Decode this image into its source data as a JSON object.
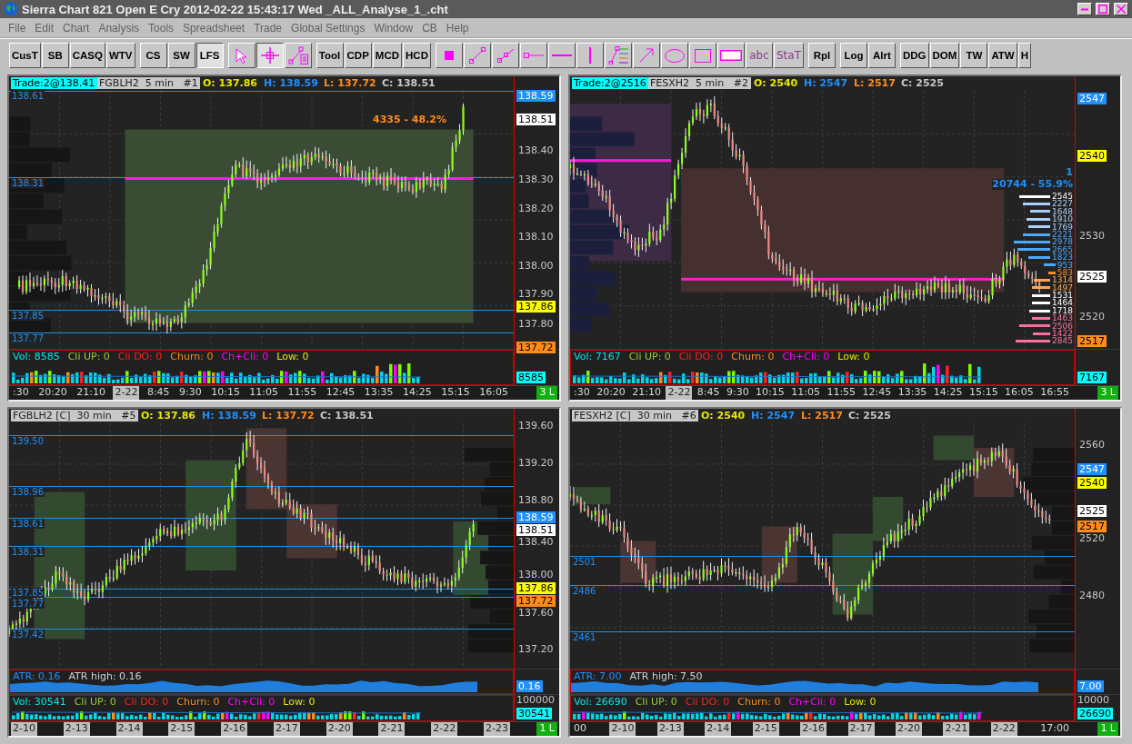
{
  "window": {
    "title": "Sierra Chart 821 Open E Cry 2012-02-22  15:43:17 Wed  _ALL_Analyse_1_.cht"
  },
  "menu": [
    "File",
    "Edit",
    "Chart",
    "Analysis",
    "Tools",
    "Spreadsheet",
    "Trade",
    "Global Settings",
    "Window",
    "CB",
    "Help"
  ],
  "toolbar": [
    [
      {
        "kind": "text",
        "label": "CusT",
        "selected": false
      },
      {
        "kind": "text",
        "label": "SB",
        "selected": false
      },
      {
        "kind": "text",
        "label": "CASQ",
        "selected": false
      },
      {
        "kind": "text",
        "label": "WTV",
        "selected": false
      }
    ],
    [
      {
        "kind": "text",
        "label": "CS",
        "selected": false
      },
      {
        "kind": "text",
        "label": "SW",
        "selected": false
      },
      {
        "kind": "text",
        "label": "LFS",
        "selected": true
      }
    ],
    [
      {
        "kind": "icon",
        "selected": false
      },
      {
        "kind": "icon",
        "selected": true
      },
      {
        "kind": "icon",
        "selected": false
      }
    ],
    [
      {
        "kind": "text",
        "label": "Tool",
        "selected": false
      },
      {
        "kind": "text",
        "label": "CDP",
        "selected": false
      },
      {
        "kind": "text",
        "label": "MCD",
        "selected": false
      },
      {
        "kind": "text",
        "label": "HCD",
        "selected": false
      }
    ],
    [
      {
        "kind": "icon",
        "selected": false
      },
      {
        "kind": "icon",
        "selected": false
      },
      {
        "kind": "icon",
        "selected": false
      },
      {
        "kind": "icon",
        "selected": false
      },
      {
        "kind": "icon",
        "selected": false
      },
      {
        "kind": "icon",
        "selected": false
      },
      {
        "kind": "icon",
        "selected": false
      },
      {
        "kind": "icon",
        "selected": false
      },
      {
        "kind": "icon",
        "selected": false
      },
      {
        "kind": "icon",
        "selected": false
      },
      {
        "kind": "icon",
        "selected": false
      },
      {
        "kind": "text",
        "label": "abc",
        "selected": false
      },
      {
        "kind": "text",
        "label": "StaT",
        "selected": false
      }
    ],
    [
      {
        "kind": "text",
        "label": "Rpl",
        "selected": false
      }
    ],
    [
      {
        "kind": "text",
        "label": "Log",
        "selected": false
      },
      {
        "kind": "text",
        "label": "Alrt",
        "selected": false
      }
    ],
    [
      {
        "kind": "text",
        "label": "DDG",
        "selected": false
      },
      {
        "kind": "text",
        "label": "DOM",
        "selected": false
      },
      {
        "kind": "text",
        "label": "TW",
        "selected": false
      },
      {
        "kind": "text",
        "label": "ATW",
        "selected": false
      },
      {
        "kind": "text",
        "label": "H",
        "selected": false
      }
    ]
  ],
  "charts": [
    {
      "header": {
        "trade": "Trade:2@138.41",
        "title": "FGBLH2  5 min   #1",
        "values": [
          {
            "text": "O: 137.86",
            "color": "#e6e600"
          },
          {
            "text": "H: 138.59",
            "color": "#1e90ff"
          },
          {
            "text": "L: 137.72",
            "color": "#ff8c1a"
          },
          {
            "text": "C: 138.51",
            "color": "#c8c8c8"
          }
        ]
      },
      "axis_labels": [
        "138.40",
        "138.30",
        "138.20",
        "138.10",
        "138.00",
        "137.90",
        "137.80"
      ],
      "price_tags": [
        {
          "text": "138.59",
          "color": "#1e90ff"
        },
        {
          "text": "138.51",
          "color": "#ffffff"
        },
        {
          "text": "137.86",
          "color": "#ffff00"
        },
        {
          "text": "137.72",
          "color": "#ff8c1a"
        }
      ],
      "level_labels": [
        "138.61",
        "138.31",
        "137.85",
        "137.77"
      ],
      "annotations": [
        {
          "text": "4335 - 48.2%",
          "color": "#ff8c1a"
        }
      ],
      "subpanels": [
        {
          "kind": "volume",
          "items": [
            {
              "text": "Vol: 8585",
              "color": "#00e5ee"
            },
            {
              "text": "Cli UP: 0",
              "color": "#9acd32"
            },
            {
              "text": "Cli DO: 0",
              "color": "#ff2020"
            },
            {
              "text": "Churn: 0",
              "color": "#ff8c1a"
            },
            {
              "text": "Ch+Cli: 0",
              "color": "#ff00ff"
            },
            {
              "text": "Low: 0",
              "color": "#e6e600"
            }
          ],
          "tag": {
            "text": "8585",
            "color": "#00ffff"
          }
        }
      ],
      "time_axis": {
        "labels": [
          {
            "text": ":30",
            "highlighted": false
          },
          {
            "text": "20:20",
            "highlighted": false
          },
          {
            "text": "21:10",
            "highlighted": false
          },
          {
            "text": "2-22",
            "highlighted": true
          },
          {
            "text": "8:45",
            "highlighted": false
          },
          {
            "text": "9:30",
            "highlighted": false
          },
          {
            "text": "10:15",
            "highlighted": false
          },
          {
            "text": "11:05",
            "highlighted": false
          },
          {
            "text": "11:55",
            "highlighted": false
          },
          {
            "text": "12:45",
            "highlighted": false
          },
          {
            "text": "13:35",
            "highlighted": false
          },
          {
            "text": "14:25",
            "highlighted": false
          },
          {
            "text": "15:15",
            "highlighted": false
          },
          {
            "text": "16:05",
            "highlighted": false
          }
        ],
        "corner": "3 L"
      }
    },
    {
      "header": {
        "trade": "Trade:2@2516",
        "title": "FESXH2  5 min   #2",
        "values": [
          {
            "text": "O: 2540",
            "color": "#e6e600"
          },
          {
            "text": "H: 2547",
            "color": "#1e90ff"
          },
          {
            "text": "L: 2517",
            "color": "#ff8c1a"
          },
          {
            "text": "C: 2525",
            "color": "#c8c8c8"
          }
        ]
      },
      "axis_labels": [
        "2530",
        "2520"
      ],
      "price_tags": [
        {
          "text": "2547",
          "color": "#1e90ff"
        },
        {
          "text": "2540",
          "color": "#ffff00"
        },
        {
          "text": "2525",
          "color": "#ffffff"
        },
        {
          "text": "2517",
          "color": "#ff8c1a"
        }
      ],
      "annotations": [
        {
          "text": "1",
          "color": "#1e90ff"
        },
        {
          "text": "20744 - 55.9%",
          "color": "#1e90ff"
        }
      ],
      "profile_labels": [
        {
          "text": "2545",
          "color": "#ffffff"
        },
        {
          "text": "2227",
          "color": "#a8d0ff"
        },
        {
          "text": "1648",
          "color": "#a8d0ff"
        },
        {
          "text": "1910",
          "color": "#a8d0ff"
        },
        {
          "text": "1769",
          "color": "#a8d0ff"
        },
        {
          "text": "2221",
          "color": "#4aa8ff"
        },
        {
          "text": "2978",
          "color": "#4aa8ff"
        },
        {
          "text": "2665",
          "color": "#4aa8ff"
        },
        {
          "text": "1823",
          "color": "#4aa8ff"
        },
        {
          "text": "953",
          "color": "#4aa8ff"
        },
        {
          "text": "583",
          "color": "#ff8c1a"
        },
        {
          "text": "1314",
          "color": "#ffa64d"
        },
        {
          "text": "1497",
          "color": "#ffa64d"
        },
        {
          "text": "1531",
          "color": "#ffffff"
        },
        {
          "text": "1464",
          "color": "#ffffff"
        },
        {
          "text": "1718",
          "color": "#ffffff"
        },
        {
          "text": "1463",
          "color": "#ff6f9f"
        },
        {
          "text": "2506",
          "color": "#ff6f9f"
        },
        {
          "text": "1422",
          "color": "#ff6f9f"
        },
        {
          "text": "2845",
          "color": "#ff6f9f"
        }
      ],
      "subpanels": [
        {
          "kind": "volume",
          "items": [
            {
              "text": "Vol: 7167",
              "color": "#00e5ee"
            },
            {
              "text": "Cli UP: 0",
              "color": "#9acd32"
            },
            {
              "text": "Cli DO: 0",
              "color": "#ff2020"
            },
            {
              "text": "Churn: 0",
              "color": "#ff8c1a"
            },
            {
              "text": "Ch+Cli: 0",
              "color": "#ff00ff"
            },
            {
              "text": "Low: 0",
              "color": "#e6e600"
            }
          ],
          "tag": {
            "text": "7167",
            "color": "#00ffff"
          }
        }
      ],
      "time_axis": {
        "labels": [
          {
            "text": ":30",
            "highlighted": false
          },
          {
            "text": "20:20",
            "highlighted": false
          },
          {
            "text": "21:10",
            "highlighted": false
          },
          {
            "text": "2-22",
            "highlighted": true
          },
          {
            "text": "8:45",
            "highlighted": false
          },
          {
            "text": "9:30",
            "highlighted": false
          },
          {
            "text": "10:15",
            "highlighted": false
          },
          {
            "text": "11:05",
            "highlighted": false
          },
          {
            "text": "11:55",
            "highlighted": false
          },
          {
            "text": "12:45",
            "highlighted": false
          },
          {
            "text": "13:35",
            "highlighted": false
          },
          {
            "text": "14:25",
            "highlighted": false
          },
          {
            "text": "15:15",
            "highlighted": false
          },
          {
            "text": "16:05",
            "highlighted": false
          },
          {
            "text": "16:55",
            "highlighted": false
          }
        ],
        "corner": "3 L"
      }
    },
    {
      "header": {
        "title": "FGBLH2 [C]  30 min   #5",
        "values": [
          {
            "text": "O: 137.86",
            "color": "#e6e600"
          },
          {
            "text": "H: 138.59",
            "color": "#1e90ff"
          },
          {
            "text": "L: 137.72",
            "color": "#ff8c1a"
          },
          {
            "text": "C: 138.51",
            "color": "#c8c8c8"
          }
        ]
      },
      "axis_labels": [
        "139.60",
        "139.20",
        "138.80",
        "138.40",
        "138.00",
        "137.60",
        "137.20"
      ],
      "price_tags": [
        {
          "text": "138.59",
          "color": "#1e90ff"
        },
        {
          "text": "138.51",
          "color": "#ffffff"
        },
        {
          "text": "137.86",
          "color": "#ffff00"
        },
        {
          "text": "137.72",
          "color": "#ff8c1a"
        }
      ],
      "level_labels": [
        "139.50",
        "138.96",
        "138.61",
        "138.31",
        "137.85",
        "137.77",
        "137.42"
      ],
      "subpanels": [
        {
          "kind": "atr",
          "items": [
            {
              "text": "ATR: 0.16",
              "color": "#1e90ff"
            },
            {
              "text": "ATR high: 0.16",
              "color": "#d0d0d0"
            }
          ],
          "tag": {
            "text": "0.16",
            "color": "#1e90ff"
          }
        },
        {
          "kind": "volume",
          "scale": "100000",
          "items": [
            {
              "text": "Vol: 30541",
              "color": "#00e5ee"
            },
            {
              "text": "Cli UP: 0",
              "color": "#9acd32"
            },
            {
              "text": "Cli DO: 0",
              "color": "#ff2020"
            },
            {
              "text": "Churn: 0",
              "color": "#ff8c1a"
            },
            {
              "text": "Ch+Cli: 0",
              "color": "#ff00ff"
            },
            {
              "text": "Low: 0",
              "color": "#e6e600"
            }
          ],
          "tag": {
            "text": "30541",
            "color": "#00ffff"
          }
        }
      ],
      "time_axis": {
        "labels": [
          {
            "text": "2-10",
            "highlighted": true
          },
          {
            "text": "2-13",
            "highlighted": true
          },
          {
            "text": "2-14",
            "highlighted": true
          },
          {
            "text": "2-15",
            "highlighted": true
          },
          {
            "text": "2-16",
            "highlighted": true
          },
          {
            "text": "2-17",
            "highlighted": true
          },
          {
            "text": "2-20",
            "highlighted": true
          },
          {
            "text": "2-21",
            "highlighted": true
          },
          {
            "text": "2-22",
            "highlighted": true
          },
          {
            "text": "2-23",
            "highlighted": true
          }
        ],
        "corner": "1 L"
      }
    },
    {
      "header": {
        "title": "FESXH2 [C]  30 min   #6",
        "values": [
          {
            "text": "O: 2540",
            "color": "#e6e600"
          },
          {
            "text": "H: 2547",
            "color": "#1e90ff"
          },
          {
            "text": "L: 2517",
            "color": "#ff8c1a"
          },
          {
            "text": "C: 2525",
            "color": "#c8c8c8"
          }
        ]
      },
      "axis_labels": [
        "2560",
        "2520",
        "2480"
      ],
      "price_tags": [
        {
          "text": "2547",
          "color": "#1e90ff"
        },
        {
          "text": "2540",
          "color": "#ffff00"
        },
        {
          "text": "2525",
          "color": "#ffffff"
        },
        {
          "text": "2517",
          "color": "#ff8c1a"
        }
      ],
      "level_labels": [
        "2501",
        "2486",
        "2461"
      ],
      "subpanels": [
        {
          "kind": "atr",
          "items": [
            {
              "text": "ATR: 7.00",
              "color": "#1e90ff"
            },
            {
              "text": "ATR high: 7.50",
              "color": "#d0d0d0"
            }
          ],
          "tag": {
            "text": "7.00",
            "color": "#1e90ff"
          }
        },
        {
          "kind": "volume",
          "scale": "10000",
          "items": [
            {
              "text": "Vol: 26690",
              "color": "#00e5ee"
            },
            {
              "text": "Cli UP: 0",
              "color": "#9acd32"
            },
            {
              "text": "Cli DO: 0",
              "color": "#ff2020"
            },
            {
              "text": "Churn: 0",
              "color": "#ff8c1a"
            },
            {
              "text": "Ch+Cli: 0",
              "color": "#ff00ff"
            },
            {
              "text": "Low: 0",
              "color": "#e6e600"
            }
          ],
          "tag": {
            "text": "26690",
            "color": "#00ffff"
          }
        }
      ],
      "time_axis": {
        "labels": [
          {
            "text": "00",
            "highlighted": false
          },
          {
            "text": "2-10",
            "highlighted": true
          },
          {
            "text": "2-13",
            "highlighted": true
          },
          {
            "text": "2-14",
            "highlighted": true
          },
          {
            "text": "2-15",
            "highlighted": true
          },
          {
            "text": "2-16",
            "highlighted": true
          },
          {
            "text": "2-17",
            "highlighted": true
          },
          {
            "text": "2-20",
            "highlighted": true
          },
          {
            "text": "2-21",
            "highlighted": true
          },
          {
            "text": "2-22",
            "highlighted": true
          },
          {
            "text": "17:00",
            "highlighted": false
          }
        ],
        "corner": "1 L"
      }
    }
  ]
}
